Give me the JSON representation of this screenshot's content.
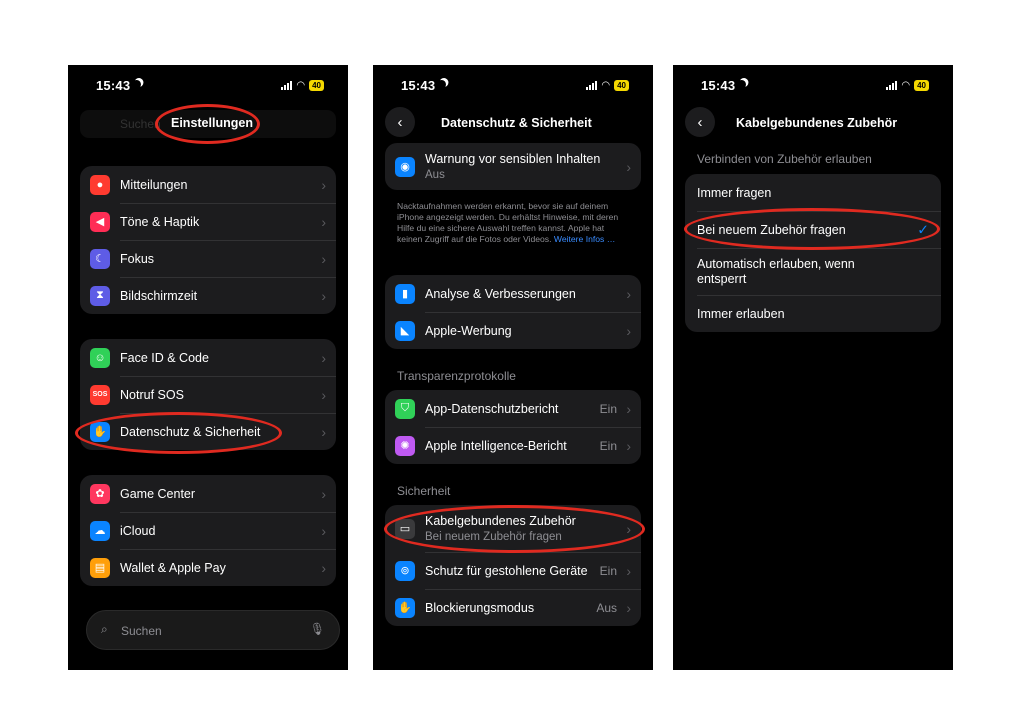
{
  "colors": {
    "accent": "#0a84ff",
    "highlight": "#e02a20",
    "battery": "#f5d800"
  },
  "status": {
    "time": "15:43",
    "battery": "40"
  },
  "panel1": {
    "search_top": "Suchen",
    "title": "Einstellungen",
    "group1": [
      {
        "label": "Mitteilungen",
        "icon": "bell-icon",
        "color": "#ff3b30"
      },
      {
        "label": "Töne & Haptik",
        "icon": "speaker-icon",
        "color": "#ff2d55"
      },
      {
        "label": "Fokus",
        "icon": "moon-icon",
        "color": "#5e5ce6"
      },
      {
        "label": "Bildschirmzeit",
        "icon": "hourglass-icon",
        "color": "#5e5ce6"
      }
    ],
    "group2": [
      {
        "label": "Face ID & Code",
        "icon": "face-id-icon",
        "color": "#30d158"
      },
      {
        "label": "Notruf SOS",
        "icon": "sos-icon",
        "color": "#ff3b30",
        "glyph": "SOS"
      },
      {
        "label": "Datenschutz & Sicherheit",
        "icon": "hand-icon",
        "color": "#0a84ff"
      }
    ],
    "group3": [
      {
        "label": "Game Center",
        "icon": "game-center-icon",
        "color": "#ff375f"
      },
      {
        "label": "iCloud",
        "icon": "cloud-icon",
        "color": "#0a84ff"
      },
      {
        "label": "Wallet & Apple Pay",
        "icon": "wallet-icon",
        "color": "#ff9f0a"
      }
    ],
    "search_bottom": "Suchen"
  },
  "panel2": {
    "title": "Datenschutz & Sicherheit",
    "warning": {
      "label": "Warnung vor sensiblen Inhalten",
      "sub": "Aus"
    },
    "footnote": "Nacktaufnahmen werden erkannt, bevor sie auf deinem iPhone angezeigt werden. Du erhältst Hinweise, mit deren Hilfe du eine sichere Auswahl treffen kannst. Apple hat keinen Zugriff auf die Fotos oder Videos.",
    "footnote_link": "Weitere Infos …",
    "group_analysis": [
      {
        "label": "Analyse & Verbesserungen",
        "icon": "chart-icon",
        "color": "#0a84ff"
      },
      {
        "label": "Apple-Werbung",
        "icon": "megaphone-icon",
        "color": "#0a84ff"
      }
    ],
    "section_transparency": "Transparenzprotokolle",
    "group_transparency": [
      {
        "label": "App-Datenschutzbericht",
        "value": "Ein",
        "icon": "shield-icon",
        "color": "#30d158"
      },
      {
        "label": "Apple Intelligence-Bericht",
        "value": "Ein",
        "icon": "apple-intelligence-icon",
        "color": "#bf5af2"
      }
    ],
    "section_security": "Sicherheit",
    "cable": {
      "label": "Kabelgebundenes Zubehör",
      "sub": "Bei neuem Zubehör fragen"
    },
    "group_security": [
      {
        "label": "Schutz für gestohlene Geräte",
        "value": "Ein",
        "icon": "stolen-device-icon",
        "color": "#0a84ff"
      },
      {
        "label": "Blockierungsmodus",
        "value": "Aus",
        "icon": "hand-icon",
        "color": "#0a84ff"
      }
    ]
  },
  "panel3": {
    "title": "Kabelgebundenes Zubehör",
    "section": "Verbinden von Zubehör erlauben",
    "options": [
      {
        "label": "Immer fragen",
        "selected": false
      },
      {
        "label": "Bei neuem Zubehör fragen",
        "selected": true
      },
      {
        "label": "Automatisch erlauben, wenn entsperrt",
        "selected": false
      },
      {
        "label": "Immer erlauben",
        "selected": false
      }
    ]
  }
}
